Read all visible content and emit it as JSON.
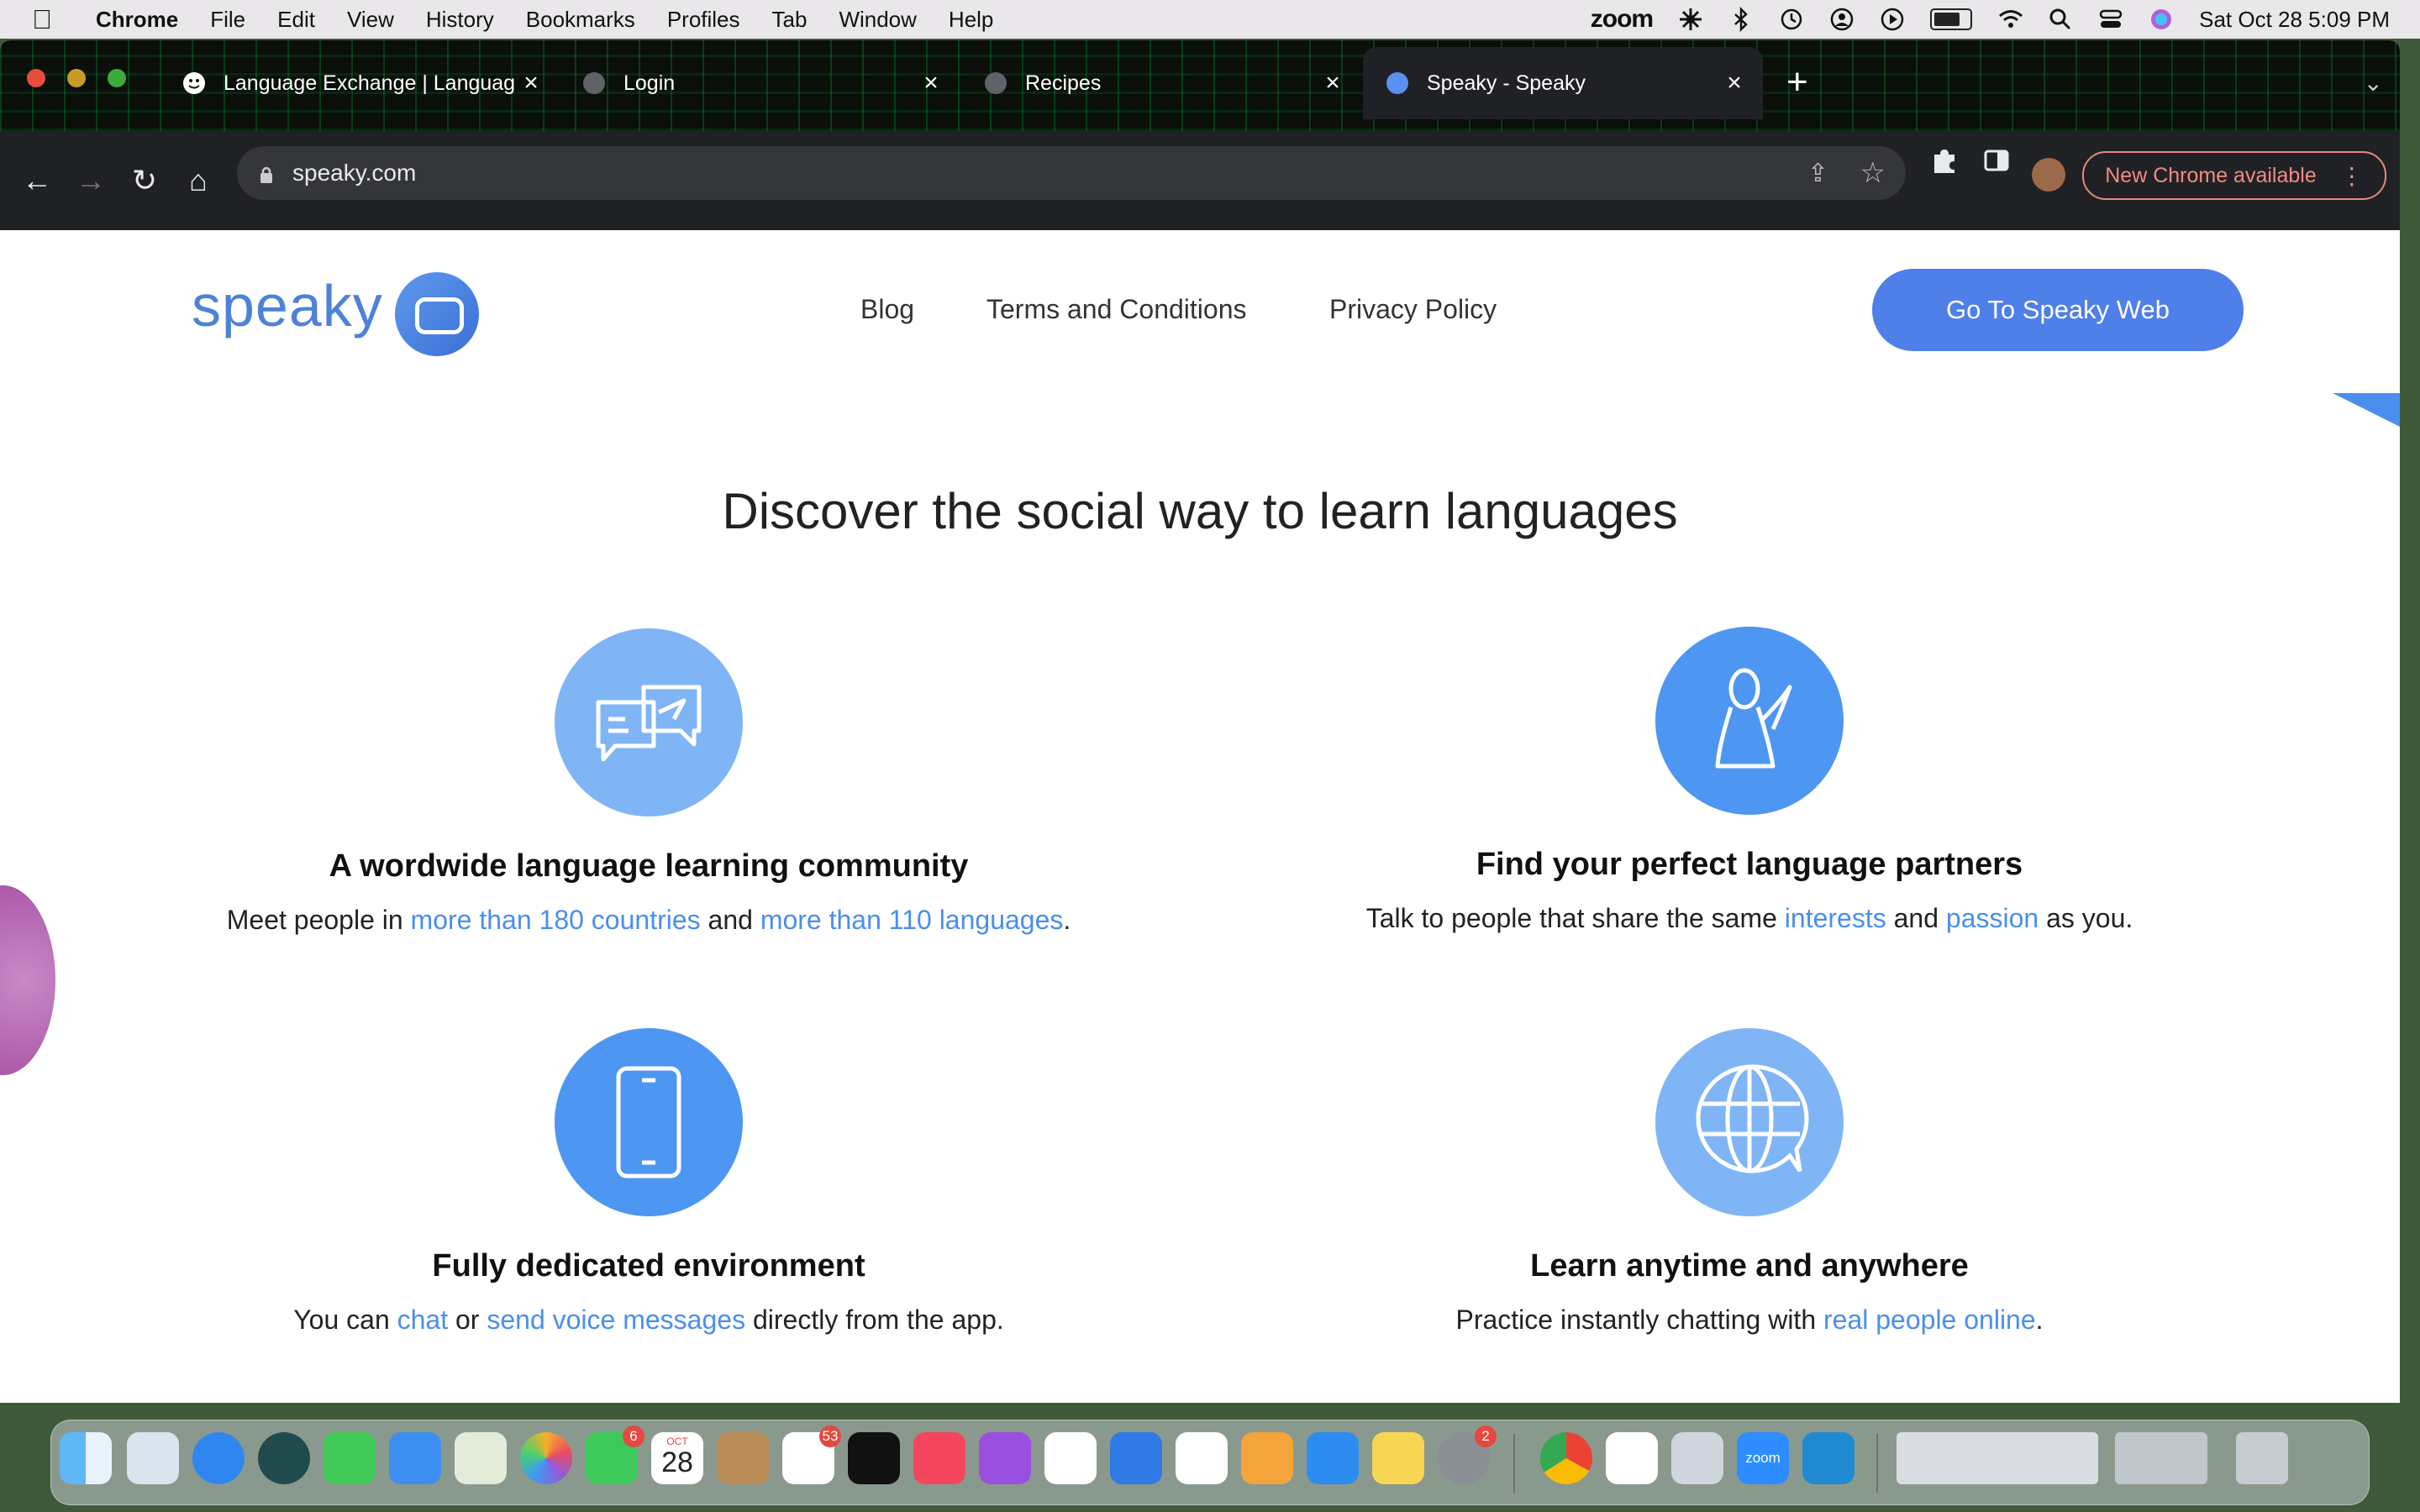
{
  "menubar": {
    "app_name": "Chrome",
    "menus": [
      "File",
      "Edit",
      "View",
      "History",
      "Bookmarks",
      "Profiles",
      "Tab",
      "Window",
      "Help"
    ],
    "zoom_label": "zoom",
    "datetime": "Sat Oct 28  5:09 PM"
  },
  "browser": {
    "tabs": [
      {
        "title": "Language Exchange | Languag",
        "favicon": "smiley-icon",
        "active": false
      },
      {
        "title": "Login",
        "favicon": "globe-icon",
        "active": false
      },
      {
        "title": "Recipes",
        "favicon": "globe-icon",
        "active": false
      },
      {
        "title": "Speaky - Speaky",
        "favicon": "speaky-icon",
        "active": true
      }
    ],
    "url": "speaky.com",
    "update_button": "New Chrome available"
  },
  "site": {
    "logo_text": "speaky",
    "nav": [
      "Blog",
      "Terms and Conditions",
      "Privacy Policy"
    ],
    "cta": "Go To Speaky Web",
    "headline": "Discover the social way to learn languages",
    "features": [
      {
        "icon": "chat-bubbles-icon",
        "title": "A wordwide language learning community",
        "desc_parts": [
          "Meet people in ",
          "more than 180 countries",
          " and ",
          "more than 110 languages",
          "."
        ]
      },
      {
        "icon": "person-waving-icon",
        "title": "Find your perfect language partners",
        "desc_parts": [
          "Talk to people that share the same ",
          "interests",
          " and ",
          "passion",
          " as you."
        ]
      },
      {
        "icon": "smartphone-icon",
        "title": "Fully dedicated environment",
        "desc_parts": [
          "You can ",
          "chat",
          " or ",
          "send voice messages",
          " directly from the app."
        ]
      },
      {
        "icon": "globe-chat-icon",
        "title": "Learn anytime and anywhere",
        "desc_parts": [
          "Practice instantly chatting with ",
          "real people online",
          "."
        ]
      }
    ]
  },
  "dock": {
    "facetime_badge": "6",
    "calendar_month": "OCT",
    "calendar_day": "28",
    "reminders_badge": "53",
    "settings_badge": "2",
    "zoom_label": "zoom"
  },
  "colors": {
    "accent": "#4f7fe8",
    "link": "#4a8ef0",
    "icon_light": "#7fb5f5",
    "icon_dark": "#4d96f2"
  }
}
